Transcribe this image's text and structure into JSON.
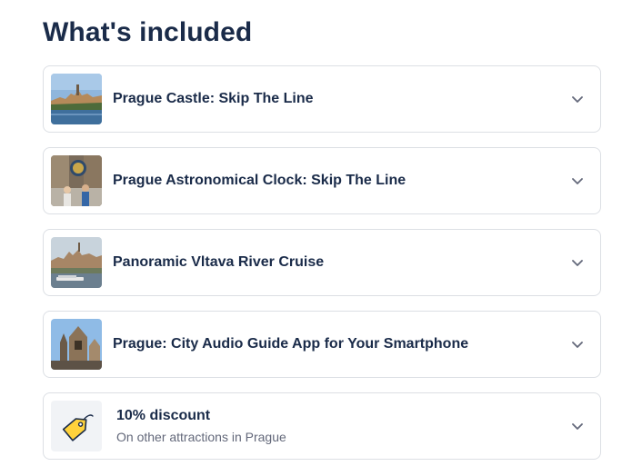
{
  "heading": "What's included",
  "items": [
    {
      "title": "Prague Castle: Skip The Line"
    },
    {
      "title": "Prague Astronomical Clock: Skip The Line"
    },
    {
      "title": "Panoramic Vltava River Cruise"
    },
    {
      "title": "Prague: City Audio Guide App for Your Smartphone"
    }
  ],
  "discount": {
    "title": "10% discount",
    "subtitle": "On other attractions in Prague"
  },
  "icons": {
    "expand": "chevron-down-icon",
    "discount": "price-tag-icon"
  },
  "colors": {
    "heading": "#1a2b49",
    "text": "#1a2b49",
    "muted": "#63687a",
    "border": "#dcdfe4",
    "tag": "#ffd23c"
  }
}
